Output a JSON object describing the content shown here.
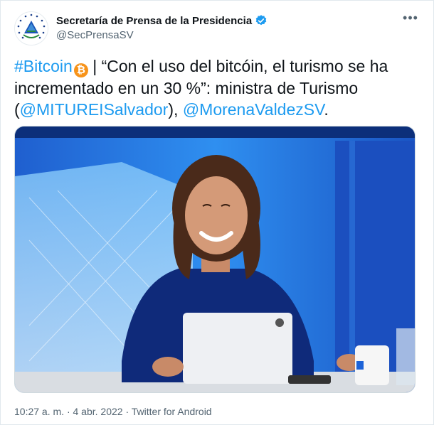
{
  "account": {
    "name": "Secretaría de Prensa de la Presidencia",
    "handle": "@SecPrensaSV",
    "verified": true,
    "avatar_icon": "el-salvador-coat-of-arms-icon"
  },
  "more_icon": "more-horizontal-icon",
  "tweet": {
    "hashtag": "#Bitcoin",
    "bitcoin_emoji": "₿",
    "text_part1": "| “Con el uso del bitcóin, el turismo se ha incrementado en un 30 %”: ministra de Turismo (",
    "mention1": "@MITUREISalvador",
    "text_part2": "),",
    "mention2": "@MorenaValdezSV",
    "text_part3": "."
  },
  "media": {
    "description_icon": "photo-minister-at-desk"
  },
  "meta": {
    "time": "10:27 a. m.",
    "separator1": "·",
    "date": "4 abr. 2022",
    "separator2": "·",
    "source": "Twitter for Android"
  },
  "colors": {
    "link": "#1d9bf0",
    "verified": "#1d9bf0",
    "bitcoin": "#f7931a",
    "secondary_text": "#536471"
  }
}
